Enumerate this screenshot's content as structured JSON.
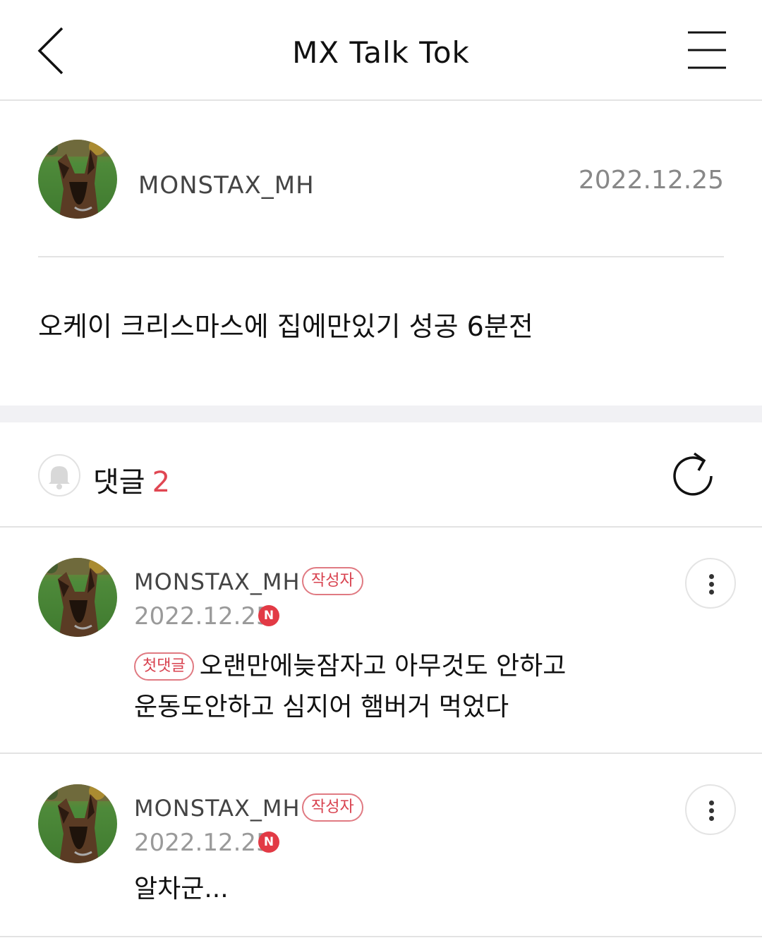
{
  "header": {
    "title": "MX Talk Tok",
    "back_icon": "chevron-left-icon",
    "menu_icon": "hamburger-menu-icon"
  },
  "post": {
    "username": "MONSTAX_MH",
    "date": "2022.12.25",
    "body": "오케이 크리스마스에 집에만있기 성공 6분전"
  },
  "comments_section": {
    "label": "댓글",
    "count": "2",
    "bell_icon": "bell-icon",
    "refresh_icon": "refresh-icon",
    "count_color": "#e04652"
  },
  "comments": [
    {
      "username": "MONSTAX_MH",
      "author_badge": "작성자",
      "date": "2022.12.25",
      "new_badge": "N",
      "first_badge": "첫댓글",
      "line1": "오랜만에늦잠자고 아무것도 안하고",
      "line2": "운동도안하고 심지어 햄버거 먹었다"
    },
    {
      "username": "MONSTAX_MH",
      "author_badge": "작성자",
      "date": "2022.12.25",
      "new_badge": "N",
      "text": "알차군..."
    }
  ],
  "colors": {
    "accent_red": "#e23a45",
    "badge_border": "#e07a82",
    "divider": "#e3e3e3",
    "section_gap": "#f1f1f4"
  }
}
